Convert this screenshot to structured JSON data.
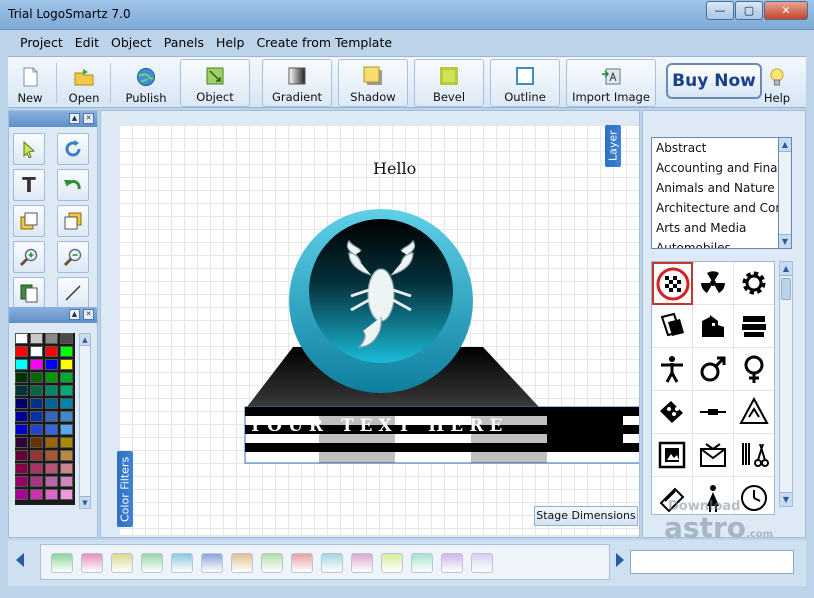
{
  "window": {
    "title": "Trial LogoSmartz 7.0"
  },
  "menu": [
    "Project",
    "Edit",
    "Object",
    "Panels",
    "Help",
    "Create from Template"
  ],
  "toolbar": {
    "new": "New",
    "open": "Open",
    "publish": "Publish",
    "object": "Object",
    "gradient": "Gradient",
    "shadow": "Shadow",
    "bevel": "Bevel",
    "outline": "Outline",
    "import_image": "Import Image",
    "buy_now": "Buy Now",
    "help": "Help"
  },
  "canvas": {
    "text": "Hello",
    "banner_text": "YOUR TEXT HERE",
    "layer_tab": "Layer",
    "color_filters_tab": "Color Filters",
    "stage_dimensions": "Stage Dimensions"
  },
  "categories": [
    "Abstract",
    "Accounting and Finan",
    "Animals and Nature",
    "Architecture and Cons",
    "Arts and Media",
    "Automobiles"
  ],
  "watermark": {
    "line1": "Download",
    "line2": "astro",
    "suffix": ".com"
  },
  "colors": {
    "accent": "#2e6fc2",
    "logo_teal": "#1ba7c9",
    "buy_now_text": "#1a3f8a"
  }
}
